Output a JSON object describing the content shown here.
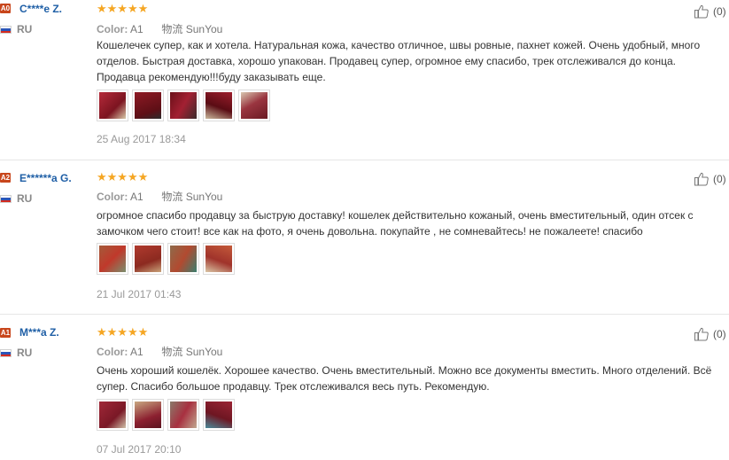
{
  "labels": {
    "color": "Color:",
    "shipping": "物流"
  },
  "reviews": [
    {
      "badge": "A0",
      "name": "C****e Z.",
      "country": "RU",
      "stars": "★★★★★",
      "color_value": "A1",
      "shipping_value": "SunYou",
      "text": "Кошелечек супер, как и хотела. Натуральная кожа, качество отличное, швы ровные, пахнет кожей. Очень удобный, много отделов. Быстрая доставка, хорошо упакован. Продавец супер, огромное ему спасибо, трек отслеживался до конца. Продавца рекомендую!!!буду заказывать еще.",
      "date": "25 Aug 2017 18:34",
      "likes": "(0)"
    },
    {
      "badge": "A2",
      "name": "E******a G.",
      "country": "RU",
      "stars": "★★★★★",
      "color_value": "A1",
      "shipping_value": "SunYou",
      "text": "огромное спасибо продавцу за быструю доставку! кошелек действительно кожаный, очень вместительный, один отсек с замочком чего стоит! все как на фото, я очень довольна. покупайте , не сомневайтесь! не пожалеете! спасибо",
      "date": "21 Jul 2017 01:43",
      "likes": "(0)"
    },
    {
      "badge": "A1",
      "name": "M***a Z.",
      "country": "RU",
      "stars": "★★★★★",
      "color_value": "A1",
      "shipping_value": "SunYou",
      "text": "Очень хороший кошелёк. Хорошее качество. Очень вместительный. Можно все документы вместить. Много отделений. Всё супер. Спасибо большое продавцу. Трек отслеживался весь путь. Рекомендую.",
      "date": "07 Jul 2017 20:10",
      "likes": "(0)"
    }
  ],
  "colors": {
    "name_link": "#1f5fa6",
    "star": "#f5a623",
    "badge": "#c8461c"
  }
}
